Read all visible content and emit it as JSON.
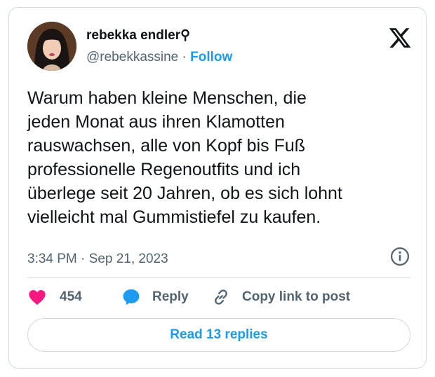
{
  "author": {
    "display_name": "rebekka endler⚲",
    "handle": "@rebekkassine",
    "separator": " · ",
    "follow_label": "Follow"
  },
  "tweet": {
    "text": "Warum haben kleine Menschen, die\njeden Monat aus ihren Klamotten\nrauswachsen, alle von Kopf bis Fuß\nprofessionelle Regenoutfits und ich\nüberlege seit 20 Jahren, ob es sich lohnt\nvielleicht mal Gummistiefel zu kaufen.",
    "timestamp": "3:34 PM · Sep 21, 2023"
  },
  "actions": {
    "like_count": "454",
    "reply_label": "Reply",
    "copy_label": "Copy link to post"
  },
  "read_replies_label": "Read 13 replies",
  "colors": {
    "accent": "#1d9bf0",
    "heart": "#f91880",
    "text": "#0f1419",
    "muted": "#536471",
    "border": "#cfd9de"
  },
  "icons": {
    "logo": "x-logo-icon",
    "info": "info-icon",
    "like": "heart-icon",
    "reply": "reply-bubble-icon",
    "copy": "link-icon"
  }
}
